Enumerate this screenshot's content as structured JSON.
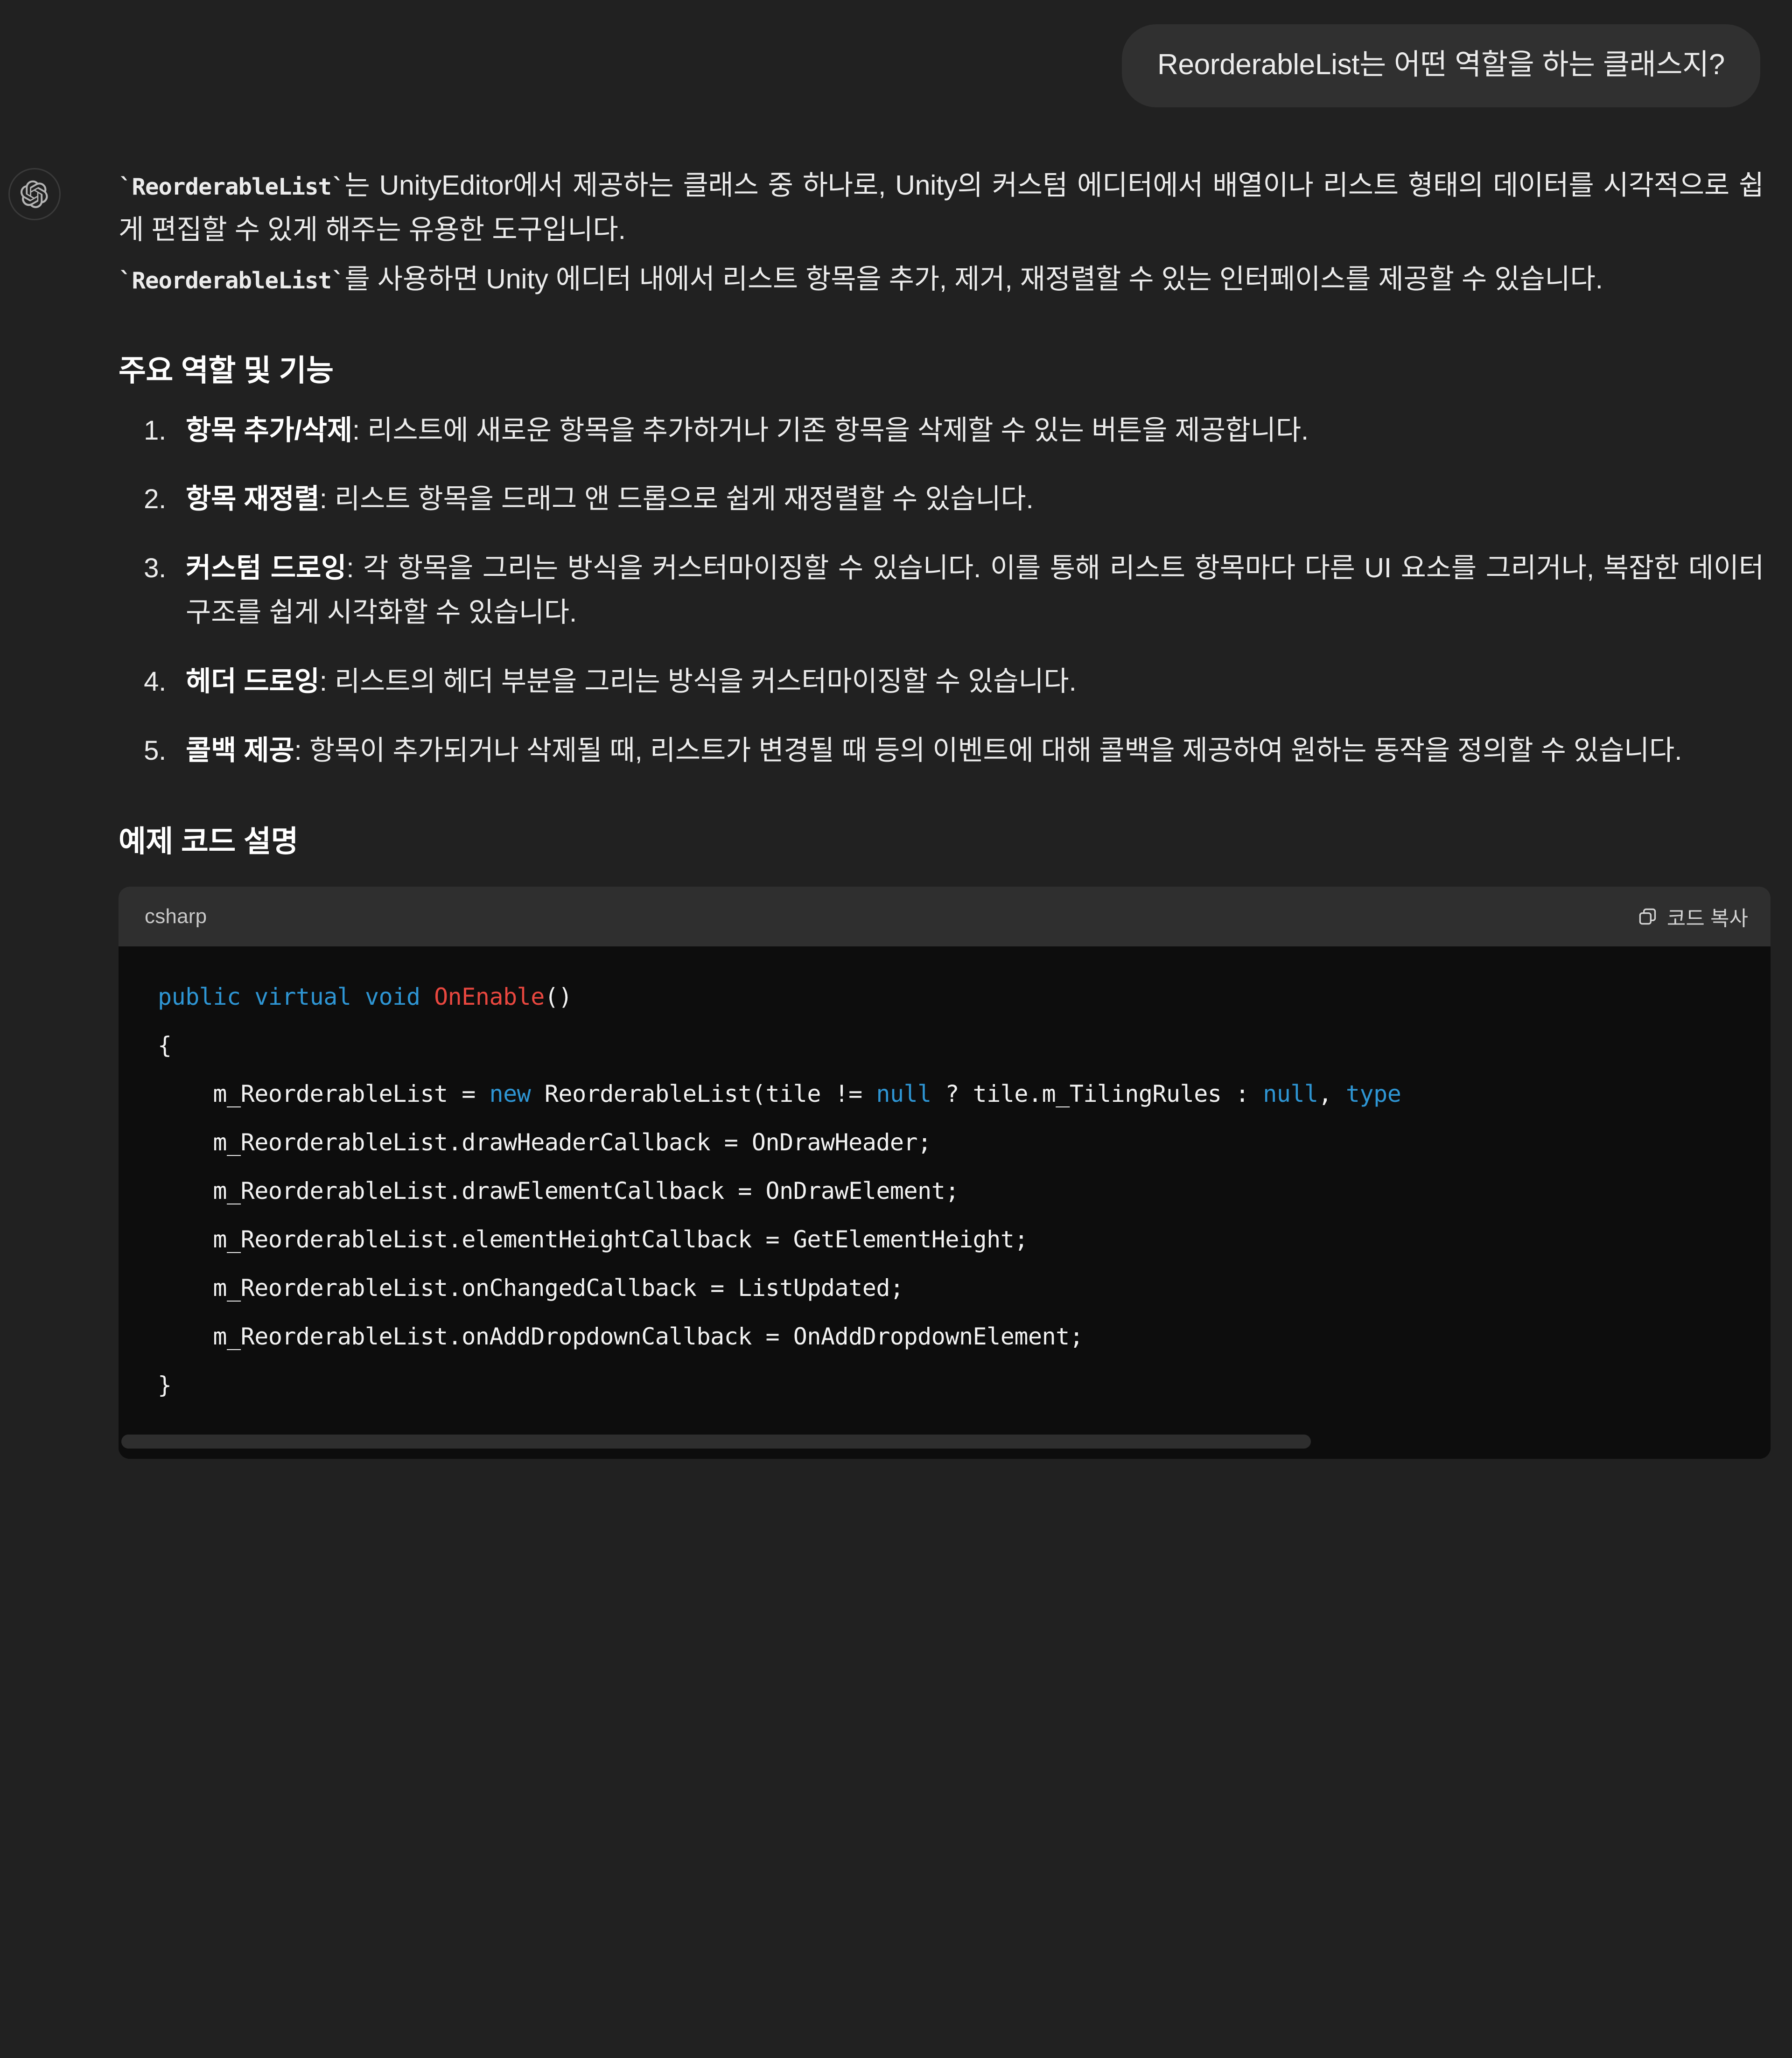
{
  "conversation": {
    "user_message": {
      "text": "ReorderableList는 어떤 역할을 하는 클래스지?"
    },
    "assistant_message": {
      "avatar_icon": "openai-logo-icon",
      "paragraph1": {
        "code1": "`ReorderableList`",
        "text1": "는 UnityEditor에서 제공하는 클래스 중 하나로, Unity의 커스텀 에디터에서 배열이나 리스트 형태의 데이터를 시각적으로 쉽게 편집할 수 있게 해주는 유용한 도구입니다."
      },
      "paragraph2": {
        "code1": "`ReorderableList`",
        "text1": "를 사용하면 Unity 에디터 내에서 리스트 항목을 추가, 제거, 재정렬할 수 있는 인터페이스를 제공할 수 있습니다."
      },
      "heading1": "주요 역할 및 기능",
      "features": [
        {
          "term": "항목 추가/삭제",
          "desc": ": 리스트에 새로운 항목을 추가하거나 기존 항목을 삭제할 수 있는 버튼을 제공합니다."
        },
        {
          "term": "항목 재정렬",
          "desc": ": 리스트 항목을 드래그 앤 드롭으로 쉽게 재정렬할 수 있습니다."
        },
        {
          "term": "커스텀 드로잉",
          "desc": ": 각 항목을 그리는 방식을 커스터마이징할 수 있습니다. 이를 통해 리스트 항목마다 다른 UI 요소를 그리거나, 복잡한 데이터 구조를 쉽게 시각화할 수 있습니다."
        },
        {
          "term": "헤더 드로잉",
          "desc": ": 리스트의 헤더 부분을 그리는 방식을 커스터마이징할 수 있습니다."
        },
        {
          "term": "콜백 제공",
          "desc": ": 항목이 추가되거나 삭제될 때, 리스트가 변경될 때 등의 이벤트에 대해 콜백을 제공하여 원하는 동작을 정의할 수 있습니다."
        }
      ],
      "heading2": "예제 코드 설명",
      "code_block": {
        "language_label": "csharp",
        "copy_label": "코드 복사",
        "copy_icon": "copy-icon",
        "lines": [
          {
            "segments": [
              {
                "t": "public virtual void ",
                "c": "kw"
              },
              {
                "t": "OnEnable",
                "c": "fn2"
              },
              {
                "t": "()",
                "c": "pl"
              }
            ]
          },
          {
            "segments": [
              {
                "t": "{",
                "c": "pl"
              }
            ]
          },
          {
            "segments": [
              {
                "t": "    m_ReorderableList = ",
                "c": "pl"
              },
              {
                "t": "new ",
                "c": "kw"
              },
              {
                "t": "ReorderableList(tile != ",
                "c": "pl"
              },
              {
                "t": "null",
                "c": "kw"
              },
              {
                "t": " ? tile.m_TilingRules : ",
                "c": "pl"
              },
              {
                "t": "null",
                "c": "kw"
              },
              {
                "t": ", ",
                "c": "pl"
              },
              {
                "t": "type",
                "c": "kw"
              }
            ]
          },
          {
            "segments": [
              {
                "t": "    m_ReorderableList.drawHeaderCallback = OnDrawHeader;",
                "c": "pl"
              }
            ]
          },
          {
            "segments": [
              {
                "t": "    m_ReorderableList.drawElementCallback = OnDrawElement;",
                "c": "pl"
              }
            ]
          },
          {
            "segments": [
              {
                "t": "    m_ReorderableList.elementHeightCallback = GetElementHeight;",
                "c": "pl"
              }
            ]
          },
          {
            "segments": [
              {
                "t": "    m_ReorderableList.onChangedCallback = ListUpdated;",
                "c": "pl"
              }
            ]
          },
          {
            "segments": [
              {
                "t": "    m_ReorderableList.onAddDropdownCallback = OnAddDropdownElement;",
                "c": "pl"
              }
            ]
          },
          {
            "segments": [
              {
                "t": "}",
                "c": "pl"
              }
            ]
          }
        ],
        "scrollbar_thumb_percent": 72
      }
    }
  },
  "colors": {
    "page_background": "#212121",
    "user_bubble": "#303030",
    "code_header": "#2f2f2f",
    "code_body": "#0d0d0d",
    "text_primary": "#ececec",
    "keyword": "#2e95d3",
    "function": "#e8473f"
  }
}
